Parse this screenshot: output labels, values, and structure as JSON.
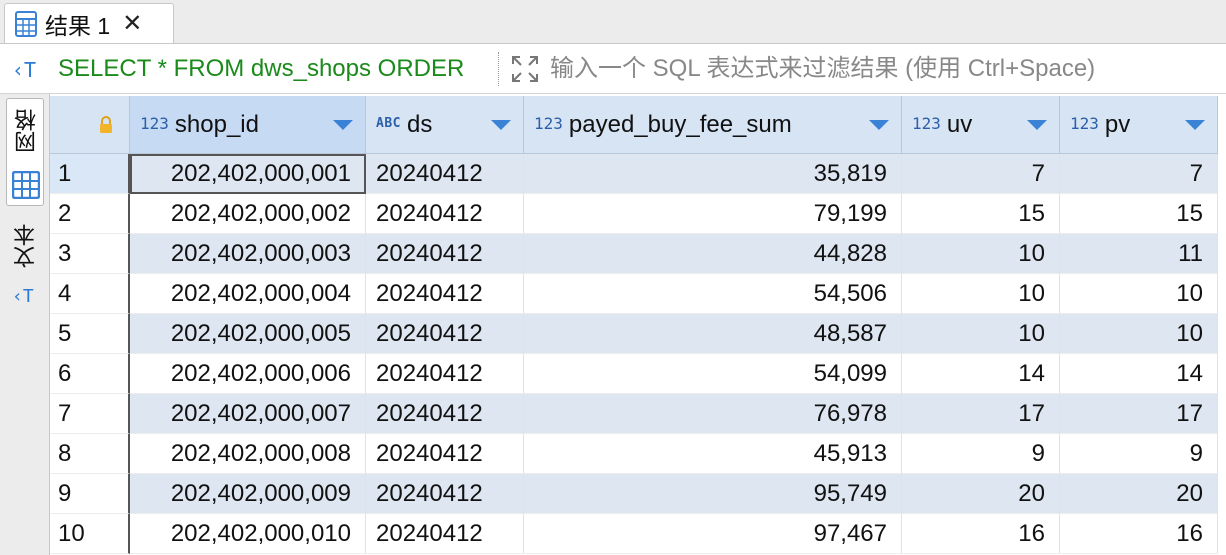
{
  "tab": {
    "label": "结果 1",
    "close_glyph": "✕",
    "icon": "table-icon"
  },
  "filter": {
    "sql": "SELECT * FROM dws_shops ORDER",
    "placeholder": "输入一个 SQL 表达式来过滤结果 (使用 Ctrl+Space)",
    "value": ""
  },
  "side": {
    "grid_label": "网格",
    "text_label": "文本"
  },
  "columns": [
    {
      "type": "123",
      "name": "shop_id"
    },
    {
      "type": "ABC",
      "name": "ds"
    },
    {
      "type": "123",
      "name": "payed_buy_fee_sum"
    },
    {
      "type": "123",
      "name": "uv"
    },
    {
      "type": "123",
      "name": "pv"
    }
  ],
  "rows": [
    {
      "n": "1",
      "shop_id": "202,402,000,001",
      "ds": "20240412",
      "payed_buy_fee_sum": "35,819",
      "uv": "7",
      "pv": "7"
    },
    {
      "n": "2",
      "shop_id": "202,402,000,002",
      "ds": "20240412",
      "payed_buy_fee_sum": "79,199",
      "uv": "15",
      "pv": "15"
    },
    {
      "n": "3",
      "shop_id": "202,402,000,003",
      "ds": "20240412",
      "payed_buy_fee_sum": "44,828",
      "uv": "10",
      "pv": "11"
    },
    {
      "n": "4",
      "shop_id": "202,402,000,004",
      "ds": "20240412",
      "payed_buy_fee_sum": "54,506",
      "uv": "10",
      "pv": "10"
    },
    {
      "n": "5",
      "shop_id": "202,402,000,005",
      "ds": "20240412",
      "payed_buy_fee_sum": "48,587",
      "uv": "10",
      "pv": "10"
    },
    {
      "n": "6",
      "shop_id": "202,402,000,006",
      "ds": "20240412",
      "payed_buy_fee_sum": "54,099",
      "uv": "14",
      "pv": "14"
    },
    {
      "n": "7",
      "shop_id": "202,402,000,007",
      "ds": "20240412",
      "payed_buy_fee_sum": "76,978",
      "uv": "17",
      "pv": "17"
    },
    {
      "n": "8",
      "shop_id": "202,402,000,008",
      "ds": "20240412",
      "payed_buy_fee_sum": "45,913",
      "uv": "9",
      "pv": "9"
    },
    {
      "n": "9",
      "shop_id": "202,402,000,009",
      "ds": "20240412",
      "payed_buy_fee_sum": "95,749",
      "uv": "20",
      "pv": "20"
    },
    {
      "n": "10",
      "shop_id": "202,402,000,010",
      "ds": "20240412",
      "payed_buy_fee_sum": "97,467",
      "uv": "16",
      "pv": "16"
    }
  ],
  "colors": {
    "sql_keyword": "#1a8a1a",
    "accent": "#3a82d6",
    "odd_row": "#dde6f1",
    "header": "#d7e4f4"
  }
}
